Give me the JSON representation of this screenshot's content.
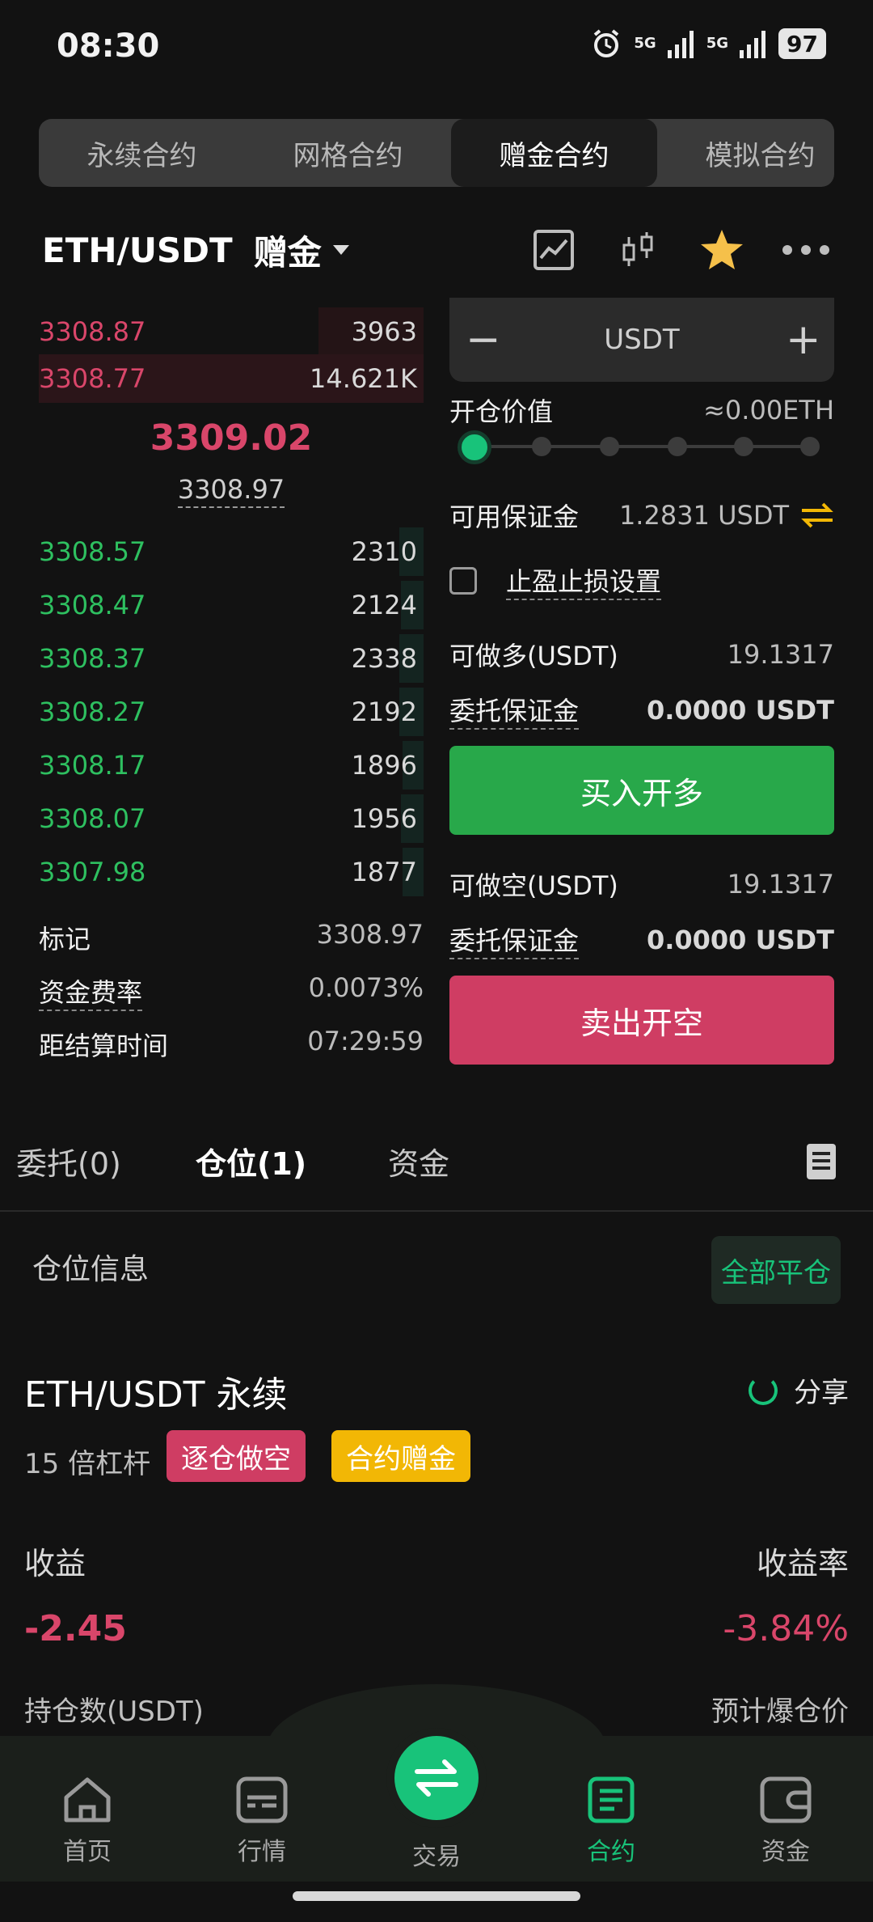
{
  "status_bar": {
    "time": "08:30",
    "network_1": "5G",
    "network_2": "5G",
    "battery": "97"
  },
  "contract_tabs": [
    "永续合约",
    "网格合约",
    "赠金合约",
    "模拟合约"
  ],
  "pair": {
    "symbol": "ETH/USDT",
    "tag": "赠金"
  },
  "order_book": {
    "asks": [
      {
        "price": "3308.87",
        "qty": "3963"
      },
      {
        "price": "3308.77",
        "qty": "14.621K"
      }
    ],
    "last_price": "3309.02",
    "mark_price": "3308.97",
    "bids": [
      {
        "price": "3308.57",
        "qty": "2310"
      },
      {
        "price": "3308.47",
        "qty": "2124"
      },
      {
        "price": "3308.37",
        "qty": "2338"
      },
      {
        "price": "3308.27",
        "qty": "2192"
      },
      {
        "price": "3308.17",
        "qty": "1896"
      },
      {
        "price": "3308.07",
        "qty": "1956"
      },
      {
        "price": "3307.98",
        "qty": "1877"
      }
    ],
    "mark_label": "标记",
    "mark_value": "3308.97",
    "funding_label": "资金费率",
    "funding_value": "0.0073%",
    "settle_label": "距结算时间",
    "settle_value": "07:29:59"
  },
  "order_form": {
    "amount_unit": "USDT",
    "minus": "−",
    "plus": "+",
    "open_value_label": "开仓价值",
    "open_value": "≈0.00ETH",
    "available_label": "可用保证金",
    "available_value": "1.2831 USDT",
    "tpsl_label": "止盈止损设置",
    "long_avail_label": "可做多(USDT)",
    "long_avail_value": "19.1317",
    "long_margin_label": "委托保证金",
    "long_margin_value": "0.0000 USDT",
    "buy_label": "买入开多",
    "short_avail_label": "可做空(USDT)",
    "short_avail_value": "19.1317",
    "short_margin_label": "委托保证金",
    "short_margin_value": "0.0000 USDT",
    "sell_label": "卖出开空",
    "leverage_slider_fraction": 0
  },
  "position_tabs": {
    "orders": "委托(0)",
    "positions": "仓位(1)",
    "funds": "资金"
  },
  "position": {
    "section_title": "仓位信息",
    "close_all": "全部平仓",
    "title": "ETH/USDT 永续",
    "share": "分享",
    "leverage": "15 倍杠杆",
    "badge_mode": "逐仓做空",
    "badge_bonus": "合约赠金",
    "pnl_label": "收益",
    "pnl_value": "-2.45",
    "roe_label": "收益率",
    "roe_value": "-3.84%",
    "size_label": "持仓数(USDT)",
    "liq_label": "预计爆仓价"
  },
  "bottom_nav": {
    "home": "首页",
    "market": "行情",
    "trade": "交易",
    "contract": "合约",
    "assets": "资金"
  },
  "colors": {
    "up": "#2ec060",
    "down": "#d9466a",
    "accent": "#18c37a",
    "bonus": "#f2b705"
  }
}
